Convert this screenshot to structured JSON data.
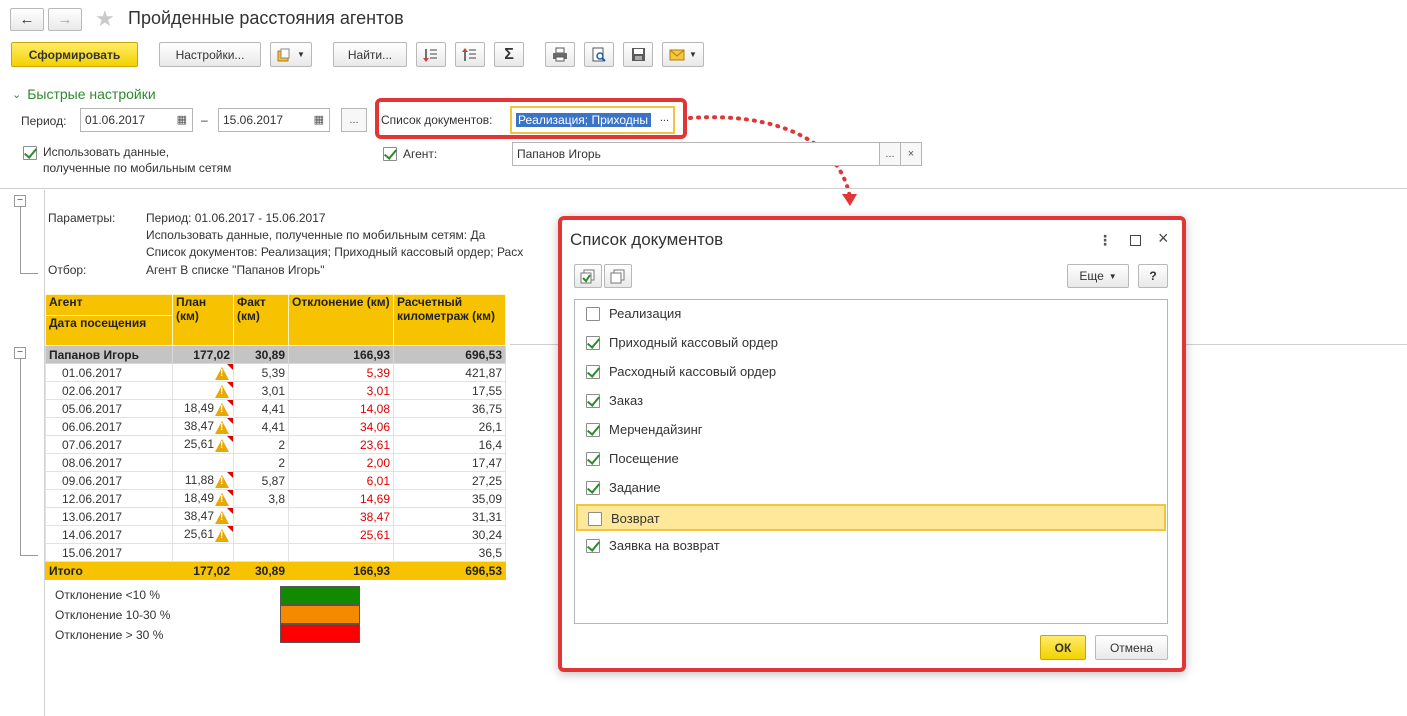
{
  "window": {
    "title": "Пройденные расстояния агентов"
  },
  "toolbar": {
    "generate_label": "Сформировать",
    "settings_label": "Настройки...",
    "find_label": "Найти...",
    "sum_symbol": "Σ"
  },
  "quick": {
    "title": "Быстрые настройки",
    "period_label": "Период:",
    "date_from": "01.06.2017",
    "date_to": "15.06.2017",
    "dash": "–",
    "ellipsis": "...",
    "doclist_label": "Список документов:",
    "doclist_value": "Реализация; Приходны",
    "mobile_line1": "Использовать данные,",
    "mobile_line2": "полученные по мобильным сетям",
    "agent_label": "Агент:",
    "agent_value": "Папанов Игорь",
    "clear": "×"
  },
  "params": {
    "params_label": "Параметры:",
    "line1": "Период: 01.06.2017 - 15.06.2017",
    "line2": "Использовать данные, полученные по мобильным сетям: Да",
    "line3": "Список документов: Реализация; Приходный кассовый ордер; Расх",
    "filter_label": "Отбор:",
    "filter_value": "Агент В списке \"Папанов Игорь\""
  },
  "report": {
    "headers": {
      "agent": "Агент",
      "date": "Дата посещения",
      "plan": "План (км)",
      "fact": "Факт (км)",
      "dev": "Отклонение (км)",
      "calc": "Расчетный километраж (км)"
    },
    "group": {
      "name": "Папанов Игорь",
      "plan": "177,02",
      "fact": "30,89",
      "dev": "166,93",
      "calc": "696,53"
    },
    "rows": [
      {
        "date": "01.06.2017",
        "plan": "",
        "warn": true,
        "fact": "5,39",
        "dev": "5,39",
        "calc": "421,87"
      },
      {
        "date": "02.06.2017",
        "plan": "",
        "warn": true,
        "fact": "3,01",
        "dev": "3,01",
        "calc": "17,55"
      },
      {
        "date": "05.06.2017",
        "plan": "18,49",
        "warn": true,
        "fact": "4,41",
        "dev": "14,08",
        "calc": "36,75"
      },
      {
        "date": "06.06.2017",
        "plan": "38,47",
        "warn": true,
        "fact": "4,41",
        "dev": "34,06",
        "calc": "26,1"
      },
      {
        "date": "07.06.2017",
        "plan": "25,61",
        "warn": true,
        "fact": "2",
        "dev": "23,61",
        "calc": "16,4"
      },
      {
        "date": "08.06.2017",
        "plan": "",
        "warn": false,
        "fact": "2",
        "dev": "2,00",
        "calc": "17,47"
      },
      {
        "date": "09.06.2017",
        "plan": "11,88",
        "warn": true,
        "fact": "5,87",
        "dev": "6,01",
        "calc": "27,25"
      },
      {
        "date": "12.06.2017",
        "plan": "18,49",
        "warn": true,
        "fact": "3,8",
        "dev": "14,69",
        "calc": "35,09"
      },
      {
        "date": "13.06.2017",
        "plan": "38,47",
        "warn": true,
        "fact": "",
        "dev": "38,47",
        "calc": "31,31"
      },
      {
        "date": "14.06.2017",
        "plan": "25,61",
        "warn": true,
        "fact": "",
        "dev": "25,61",
        "calc": "30,24"
      },
      {
        "date": "15.06.2017",
        "plan": "",
        "warn": false,
        "fact": "",
        "dev": "",
        "calc": "36,5"
      }
    ],
    "total": {
      "label": "Итого",
      "plan": "177,02",
      "fact": "30,89",
      "dev": "166,93",
      "calc": "696,53"
    }
  },
  "legend": [
    {
      "label": "Отклонение <10 %",
      "color": "#118a00"
    },
    {
      "label": "Отклонение 10-30 %",
      "color": "#f58a00"
    },
    {
      "label": "Отклонение > 30 %",
      "color": "#ff0000"
    }
  ],
  "dialog": {
    "title": "Список документов",
    "more_label": "Еще",
    "help_label": "?",
    "ok_label": "ОК",
    "cancel_label": "Отмена",
    "items": [
      {
        "label": "Реализация",
        "checked": false,
        "selected": false
      },
      {
        "label": "Приходный кассовый ордер",
        "checked": true,
        "selected": false
      },
      {
        "label": "Расходный кассовый ордер",
        "checked": true,
        "selected": false
      },
      {
        "label": "Заказ",
        "checked": true,
        "selected": false
      },
      {
        "label": "Мерчендайзинг",
        "checked": true,
        "selected": false
      },
      {
        "label": "Посещение",
        "checked": true,
        "selected": false
      },
      {
        "label": "Задание",
        "checked": true,
        "selected": false
      },
      {
        "label": "Возврат",
        "checked": false,
        "selected": true
      },
      {
        "label": "Заявка на возврат",
        "checked": true,
        "selected": false
      }
    ]
  },
  "colors": {
    "accent_yellow": "#f3d200",
    "highlight_red": "#e23636",
    "group_gray": "#c4c4c4",
    "link_green": "#2d8a2d"
  }
}
